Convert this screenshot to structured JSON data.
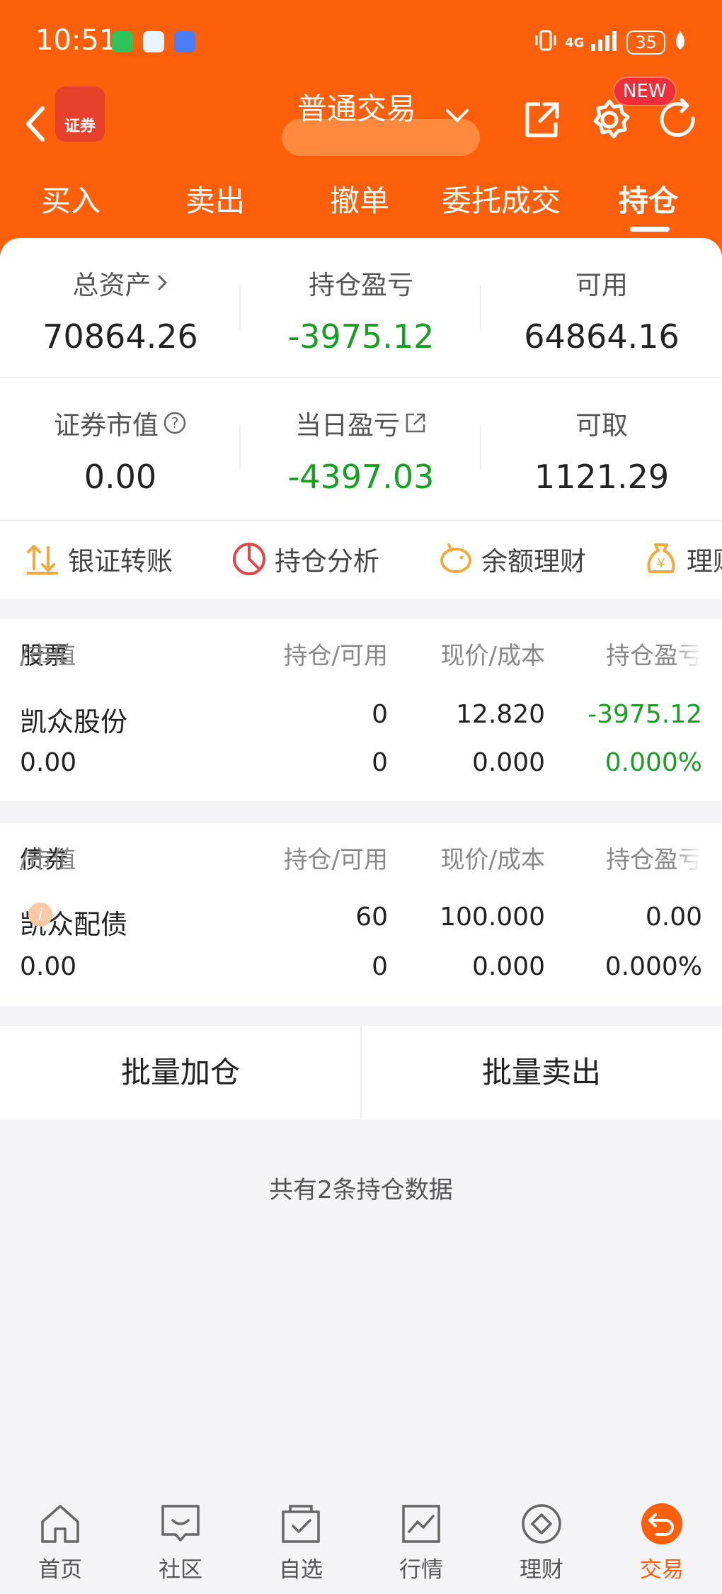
{
  "status_bar": {
    "time": "10:51",
    "battery": "35",
    "network": "4G"
  },
  "header": {
    "title": "普通交易",
    "new_badge": "NEW",
    "logo_text": "证券"
  },
  "tabs": [
    {
      "label": "买入"
    },
    {
      "label": "卖出"
    },
    {
      "label": "撤单"
    },
    {
      "label": "委托成交"
    },
    {
      "label": "持仓",
      "active": true
    }
  ],
  "summary": {
    "total_assets_label": "总资产",
    "total_assets": "70864.26",
    "position_pl_label": "持仓盈亏",
    "position_pl": "-3975.12",
    "available_label": "可用",
    "available": "64864.16",
    "securities_value_label": "证券市值",
    "securities_value": "0.00",
    "daily_pl_label": "当日盈亏",
    "daily_pl": "-4397.03",
    "withdrawable_label": "可取",
    "withdrawable": "1121.29"
  },
  "quick_actions": [
    {
      "label": "银证转账",
      "icon": "transfer-icon"
    },
    {
      "label": "持仓分析",
      "icon": "pie-chart-icon"
    },
    {
      "label": "余额理财",
      "icon": "piggy-bank-icon"
    },
    {
      "label": "理财",
      "icon": "money-bag-icon"
    }
  ],
  "stocks": {
    "header": {
      "col1_a": "股票",
      "col1_b": "/市值",
      "col2": "持仓/可用",
      "col3": "现价/成本",
      "col4": "持仓盈亏"
    },
    "rows": [
      {
        "name": "凯众股份",
        "market_value": "0.00",
        "position": "0",
        "available": "0",
        "price": "12.820",
        "cost": "0.000",
        "pl": "-3975.12",
        "pl_pct": "0.000%"
      }
    ]
  },
  "bonds": {
    "header": {
      "col1_a": "债券",
      "col1_b": "/市值",
      "col2": "持仓/可用",
      "col3": "现价/成本",
      "col4": "持仓盈亏"
    },
    "rows": [
      {
        "name": "凯众配债",
        "market_value": "0.00",
        "position": "60",
        "available": "0",
        "price": "100.000",
        "cost": "0.000",
        "pl": "0.00",
        "pl_pct": "0.000%"
      }
    ]
  },
  "batch": {
    "add_label": "批量加仓",
    "sell_label": "批量卖出"
  },
  "footer_note": "共有2条持仓数据",
  "bottom_nav": [
    {
      "label": "首页",
      "icon": "home-icon"
    },
    {
      "label": "社区",
      "icon": "community-icon"
    },
    {
      "label": "自选",
      "icon": "watchlist-icon"
    },
    {
      "label": "行情",
      "icon": "market-icon"
    },
    {
      "label": "理财",
      "icon": "wealth-icon"
    },
    {
      "label": "交易",
      "icon": "trade-icon",
      "active": true
    }
  ],
  "colors": {
    "brand": "#fe5f0b",
    "loss": "#18a025",
    "badge": "#ee2e3a"
  }
}
